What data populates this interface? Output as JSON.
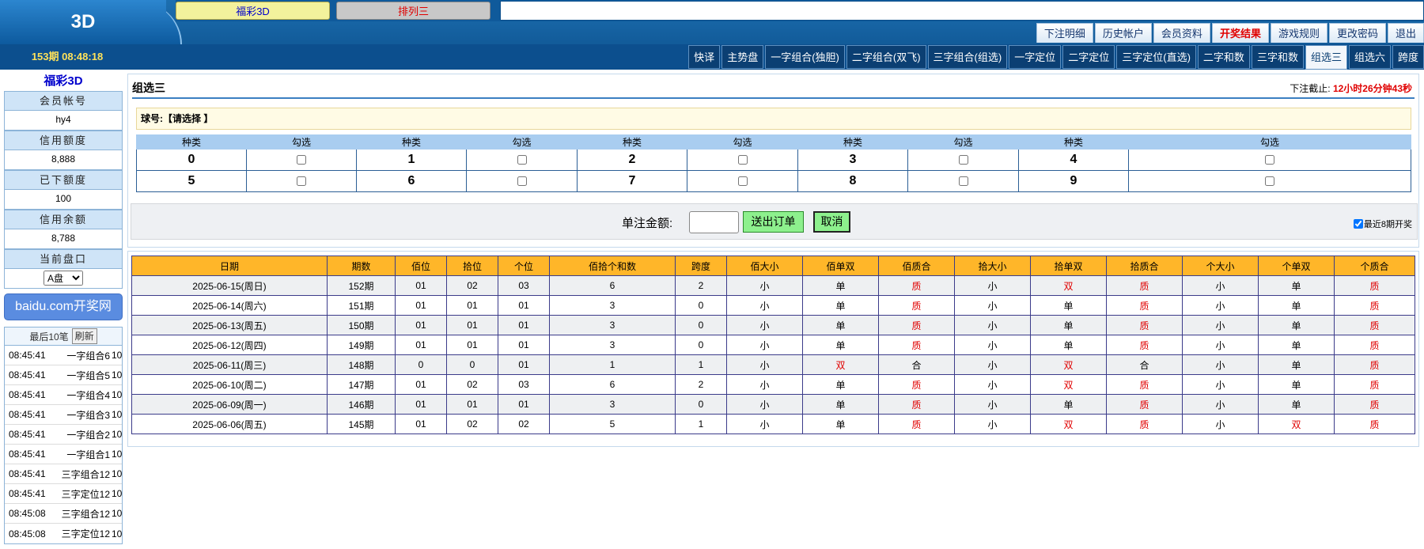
{
  "header": {
    "logo": "3D",
    "lottery_tabs": [
      "福彩3D",
      "排列三"
    ],
    "period_info": "153期 08:48:18",
    "top_nav": [
      "下注明细",
      "历史帐户",
      "会员资料",
      "开奖结果",
      "游戏规则",
      "更改密码",
      "退出"
    ],
    "top_nav_highlight": "开奖结果",
    "game_tabs": [
      "快译",
      "主势盘",
      "一字组合(独胆)",
      "二字组合(双飞)",
      "三字组合(组选)",
      "一字定位",
      "二字定位",
      "三字定位(直选)",
      "二字和数",
      "三字和数",
      "组选三",
      "组选六",
      "跨度"
    ],
    "active_game_tab": "组选三"
  },
  "sidebar": {
    "title": "福彩3D",
    "fields": [
      {
        "label": "会员帐号",
        "value": "hy4"
      },
      {
        "label": "信用额度",
        "value": "8,888"
      },
      {
        "label": "已下额度",
        "value": "100"
      },
      {
        "label": "信用余额",
        "value": "8,788"
      }
    ],
    "pan_label": "当前盘口",
    "pan_value": "A盘",
    "baidu_link": "baidu.com开奖网",
    "recent_title": "最后10笔",
    "refresh_label": "刷新",
    "recent_bets": [
      {
        "time": "08:45:41",
        "name": "一字组合6",
        "amount": "10"
      },
      {
        "time": "08:45:41",
        "name": "一字组合5",
        "amount": "10"
      },
      {
        "time": "08:45:41",
        "name": "一字组合4",
        "amount": "10"
      },
      {
        "time": "08:45:41",
        "name": "一字组合3",
        "amount": "10"
      },
      {
        "time": "08:45:41",
        "name": "一字组合2",
        "amount": "10"
      },
      {
        "time": "08:45:41",
        "name": "一字组合1",
        "amount": "10"
      },
      {
        "time": "08:45:41",
        "name": "三字组合12",
        "amount": "10"
      },
      {
        "time": "08:45:41",
        "name": "三字定位12",
        "amount": "10"
      },
      {
        "time": "08:45:08",
        "name": "三字组合12",
        "amount": "10"
      },
      {
        "time": "08:45:08",
        "name": "三字定位12",
        "amount": "10"
      }
    ]
  },
  "main": {
    "title": "组选三",
    "deadline_label": "下注截止:",
    "deadline_value": "12小时26分钟43秒",
    "ball_label": "球号:【请选择 】",
    "select_headers": [
      "种类",
      "勾选",
      "种类",
      "勾选",
      "种类",
      "勾选",
      "种类",
      "勾选",
      "种类",
      "勾选"
    ],
    "select_rows": [
      [
        "0",
        "1",
        "2",
        "3",
        "4"
      ],
      [
        "5",
        "6",
        "7",
        "8",
        "9"
      ]
    ],
    "amount_label": "单注金额:",
    "submit_label": "送出订单",
    "cancel_label": "取消",
    "recent8_label": "最近8期开奖"
  },
  "history": {
    "headers": [
      "日期",
      "期数",
      "佰位",
      "拾位",
      "个位",
      "佰拾个和数",
      "跨度",
      "佰大小",
      "佰单双",
      "佰质合",
      "拾大小",
      "拾单双",
      "拾质合",
      "个大小",
      "个单双",
      "个质合"
    ],
    "rows": [
      [
        "2025-06-15(周日)",
        "152期",
        "01",
        "02",
        "03",
        "6",
        "2",
        "小",
        "单",
        "质",
        "小",
        "双",
        "质",
        "小",
        "单",
        "质"
      ],
      [
        "2025-06-14(周六)",
        "151期",
        "01",
        "01",
        "01",
        "3",
        "0",
        "小",
        "单",
        "质",
        "小",
        "单",
        "质",
        "小",
        "单",
        "质"
      ],
      [
        "2025-06-13(周五)",
        "150期",
        "01",
        "01",
        "01",
        "3",
        "0",
        "小",
        "单",
        "质",
        "小",
        "单",
        "质",
        "小",
        "单",
        "质"
      ],
      [
        "2025-06-12(周四)",
        "149期",
        "01",
        "01",
        "01",
        "3",
        "0",
        "小",
        "单",
        "质",
        "小",
        "单",
        "质",
        "小",
        "单",
        "质"
      ],
      [
        "2025-06-11(周三)",
        "148期",
        "0",
        "0",
        "01",
        "1",
        "1",
        "小",
        "双",
        "合",
        "小",
        "双",
        "合",
        "小",
        "单",
        "质"
      ],
      [
        "2025-06-10(周二)",
        "147期",
        "01",
        "02",
        "03",
        "6",
        "2",
        "小",
        "单",
        "质",
        "小",
        "双",
        "质",
        "小",
        "单",
        "质"
      ],
      [
        "2025-06-09(周一)",
        "146期",
        "01",
        "01",
        "01",
        "3",
        "0",
        "小",
        "单",
        "质",
        "小",
        "单",
        "质",
        "小",
        "单",
        "质"
      ],
      [
        "2025-06-06(周五)",
        "145期",
        "01",
        "02",
        "02",
        "5",
        "1",
        "小",
        "单",
        "质",
        "小",
        "双",
        "质",
        "小",
        "双",
        "质"
      ]
    ],
    "red_values": [
      "双",
      "质"
    ]
  }
}
